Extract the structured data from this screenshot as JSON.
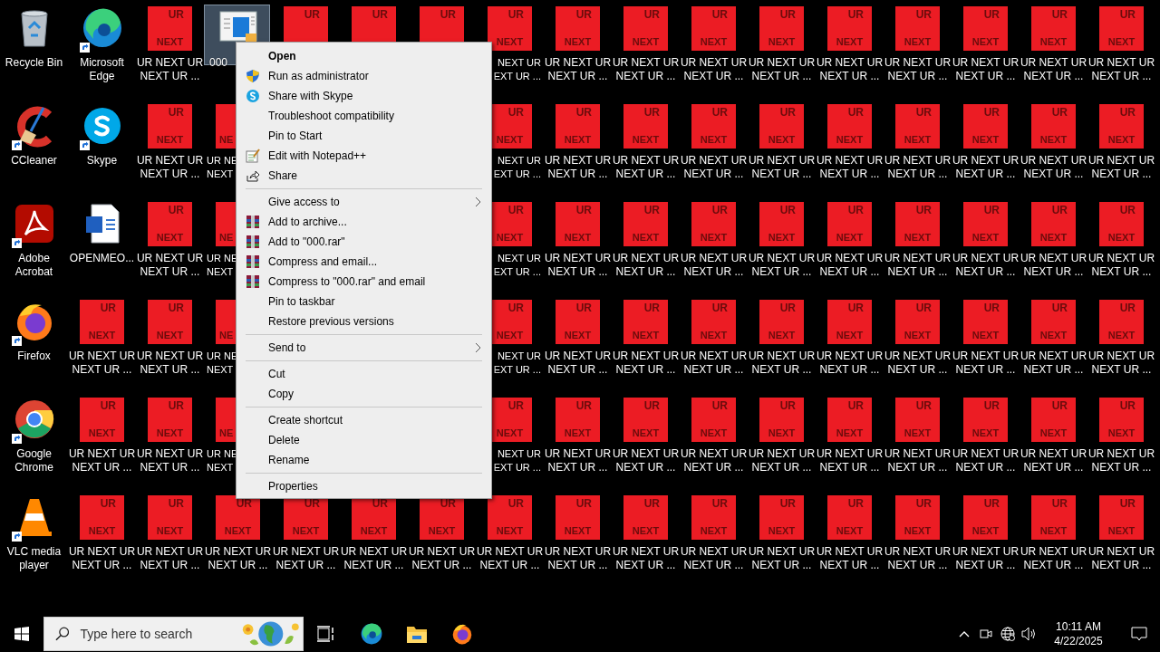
{
  "desktop": {
    "columns": [
      [
        {
          "kind": "recycle",
          "shortcut": false,
          "label": [
            "Recycle Bin"
          ]
        },
        {
          "kind": "ccleaner",
          "shortcut": true,
          "label": [
            "CCleaner"
          ]
        },
        {
          "kind": "acrobat",
          "shortcut": true,
          "label": [
            "Adobe",
            "Acrobat"
          ]
        },
        {
          "kind": "firefox",
          "shortcut": true,
          "label": [
            "Firefox"
          ]
        },
        {
          "kind": "chrome",
          "shortcut": true,
          "label": [
            "Google",
            "Chrome"
          ]
        },
        {
          "kind": "vlc",
          "shortcut": true,
          "label": [
            "VLC media",
            "player"
          ]
        }
      ],
      [
        {
          "kind": "edge",
          "shortcut": true,
          "label": [
            "Microsoft",
            "Edge"
          ]
        },
        {
          "kind": "skype",
          "shortcut": true,
          "label": [
            "Skype"
          ]
        },
        {
          "kind": "word",
          "shortcut": false,
          "label": [
            "OPENMEO..."
          ]
        },
        {
          "kind": "tile",
          "tile": {
            "top": "UR",
            "bottom": "NEXT"
          },
          "label": [
            "UR NEXT UR",
            "NEXT UR ..."
          ]
        },
        {
          "kind": "tile",
          "tile": {
            "top": "UR",
            "bottom": "NEXT"
          },
          "label": [
            "UR NEXT UR",
            "NEXT UR ..."
          ]
        },
        {
          "kind": "tile",
          "tile": {
            "top": "UR",
            "bottom": "NEXT"
          },
          "label": [
            "UR NEXT UR",
            "NEXT UR ..."
          ]
        }
      ],
      [
        {
          "kind": "tile",
          "tile": {
            "top": "UR",
            "bottom": "NEXT"
          },
          "label": [
            "UR NEXT UR",
            "NEXT UR ..."
          ]
        },
        {
          "kind": "tile",
          "tile": {
            "top": "UR",
            "bottom": "NEXT"
          },
          "label": [
            "UR NEXT UR",
            "NEXT UR ..."
          ]
        },
        {
          "kind": "tile",
          "tile": {
            "top": "UR",
            "bottom": "NEXT"
          },
          "label": [
            "UR NEXT UR",
            "NEXT UR ..."
          ]
        },
        {
          "kind": "tile",
          "tile": {
            "top": "UR",
            "bottom": "NEXT"
          },
          "label": [
            "UR NEXT UR",
            "NEXT UR ..."
          ]
        },
        {
          "kind": "tile",
          "tile": {
            "top": "UR",
            "bottom": "NEXT"
          },
          "label": [
            "UR NEXT UR",
            "NEXT UR ..."
          ]
        },
        {
          "kind": "tile",
          "tile": {
            "top": "UR",
            "bottom": "NEXT"
          },
          "label": [
            "UR NEXT UR",
            "NEXT UR ..."
          ]
        }
      ],
      [
        {
          "kind": "file",
          "selected": true,
          "label": [
            "000"
          ]
        },
        {
          "kind": "cutright",
          "tile": {
            "bottom": "NE"
          },
          "label": [
            "UR NE",
            "NEXT"
          ]
        },
        {
          "kind": "cutright",
          "tile": {
            "bottom": "NE"
          },
          "label": [
            "UR NE",
            "NEXT"
          ]
        },
        {
          "kind": "cutright",
          "tile": {
            "bottom": "NE"
          },
          "label": [
            "UR NE",
            "NEXT"
          ]
        },
        {
          "kind": "cutright",
          "tile": {
            "bottom": "NE"
          },
          "label": [
            "UR NE",
            "NEXT"
          ]
        },
        {
          "kind": "tile",
          "tile": {
            "top": "UR",
            "bottom": "NEXT"
          },
          "label": [
            "UR NEXT UR",
            "NEXT UR ..."
          ]
        }
      ],
      [
        {
          "kind": "cutbottom",
          "tile": {
            "top": "UR"
          }
        },
        {
          "kind": "covered"
        },
        {
          "kind": "covered"
        },
        {
          "kind": "covered"
        },
        {
          "kind": "covered"
        },
        {
          "kind": "tile",
          "tile": {
            "top": "UR",
            "bottom": "NEXT"
          },
          "label": [
            "UR NEXT UR",
            "NEXT UR ..."
          ]
        }
      ],
      [
        {
          "kind": "cutbottom",
          "tile": {
            "top": "UR"
          }
        },
        {
          "kind": "covered"
        },
        {
          "kind": "covered"
        },
        {
          "kind": "covered"
        },
        {
          "kind": "covered"
        },
        {
          "kind": "tile",
          "tile": {
            "top": "UR",
            "bottom": "NEXT"
          },
          "label": [
            "UR NEXT UR",
            "NEXT UR ..."
          ]
        }
      ],
      [
        {
          "kind": "cutbottom",
          "tile": {
            "top": "UR"
          }
        },
        {
          "kind": "covered"
        },
        {
          "kind": "covered"
        },
        {
          "kind": "covered"
        },
        {
          "kind": "covered"
        },
        {
          "kind": "tile",
          "tile": {
            "top": "UR",
            "bottom": "NEXT"
          },
          "label": [
            "UR NEXT UR",
            "NEXT UR ..."
          ]
        }
      ],
      [
        {
          "kind": "cutleft",
          "tile": {
            "top": "UR",
            "bottom": "NEXT"
          },
          "label": [
            "NEXT UR",
            "EXT UR ..."
          ]
        },
        {
          "kind": "cutleft",
          "tile": {
            "top": "UR",
            "bottom": "NEXT"
          },
          "label": [
            "NEXT UR",
            "EXT UR ..."
          ]
        },
        {
          "kind": "cutleft",
          "tile": {
            "top": "UR",
            "bottom": "NEXT"
          },
          "label": [
            "NEXT UR",
            "EXT UR ..."
          ]
        },
        {
          "kind": "cutleft",
          "tile": {
            "top": "UR",
            "bottom": "NEXT"
          },
          "label": [
            "NEXT UR",
            "EXT UR ..."
          ]
        },
        {
          "kind": "cutleft",
          "tile": {
            "top": "UR",
            "bottom": "NEXT"
          },
          "label": [
            "NEXT UR",
            "EXT UR ..."
          ]
        },
        {
          "kind": "tile",
          "tile": {
            "top": "UR",
            "bottom": "NEXT"
          },
          "label": [
            "UR NEXT UR",
            "NEXT UR ..."
          ]
        }
      ],
      [
        {
          "kind": "tile",
          "tile": {
            "top": "UR",
            "bottom": "NEXT"
          },
          "label": [
            "UR NEXT UR",
            "NEXT UR ..."
          ]
        },
        {
          "kind": "tile",
          "tile": {
            "top": "UR",
            "bottom": "NEXT"
          },
          "label": [
            "UR NEXT UR",
            "NEXT UR ..."
          ]
        },
        {
          "kind": "tile",
          "tile": {
            "top": "UR",
            "bottom": "NEXT"
          },
          "label": [
            "UR NEXT UR",
            "NEXT UR ..."
          ]
        },
        {
          "kind": "tile",
          "tile": {
            "top": "UR",
            "bottom": "NEXT"
          },
          "label": [
            "UR NEXT UR",
            "NEXT UR ..."
          ]
        },
        {
          "kind": "tile",
          "tile": {
            "top": "UR",
            "bottom": "NEXT"
          },
          "label": [
            "UR NEXT UR",
            "NEXT UR ..."
          ]
        },
        {
          "kind": "tile",
          "tile": {
            "top": "UR",
            "bottom": "NEXT"
          },
          "label": [
            "UR NEXT UR",
            "NEXT UR ..."
          ]
        }
      ],
      [
        {
          "kind": "tile",
          "tile": {
            "top": "UR",
            "bottom": "NEXT"
          },
          "label": [
            "UR NEXT UR",
            "NEXT UR ..."
          ]
        },
        {
          "kind": "tile",
          "tile": {
            "top": "UR",
            "bottom": "NEXT"
          },
          "label": [
            "UR NEXT UR",
            "NEXT UR ..."
          ]
        },
        {
          "kind": "tile",
          "tile": {
            "top": "UR",
            "bottom": "NEXT"
          },
          "label": [
            "UR NEXT UR",
            "NEXT UR ..."
          ]
        },
        {
          "kind": "tile",
          "tile": {
            "top": "UR",
            "bottom": "NEXT"
          },
          "label": [
            "UR NEXT UR",
            "NEXT UR ..."
          ]
        },
        {
          "kind": "tile",
          "tile": {
            "top": "UR",
            "bottom": "NEXT"
          },
          "label": [
            "UR NEXT UR",
            "NEXT UR ..."
          ]
        },
        {
          "kind": "tile",
          "tile": {
            "top": "UR",
            "bottom": "NEXT"
          },
          "label": [
            "UR NEXT UR",
            "NEXT UR ..."
          ]
        }
      ],
      [
        {
          "kind": "tile",
          "tile": {
            "top": "UR",
            "bottom": "NEXT"
          },
          "label": [
            "UR NEXT UR",
            "NEXT UR ..."
          ]
        },
        {
          "kind": "tile",
          "tile": {
            "top": "UR",
            "bottom": "NEXT"
          },
          "label": [
            "UR NEXT UR",
            "NEXT UR ..."
          ]
        },
        {
          "kind": "tile",
          "tile": {
            "top": "UR",
            "bottom": "NEXT"
          },
          "label": [
            "UR NEXT UR",
            "NEXT UR ..."
          ]
        },
        {
          "kind": "tile",
          "tile": {
            "top": "UR",
            "bottom": "NEXT"
          },
          "label": [
            "UR NEXT UR",
            "NEXT UR ..."
          ]
        },
        {
          "kind": "tile",
          "tile": {
            "top": "UR",
            "bottom": "NEXT"
          },
          "label": [
            "UR NEXT UR",
            "NEXT UR ..."
          ]
        },
        {
          "kind": "tile",
          "tile": {
            "top": "UR",
            "bottom": "NEXT"
          },
          "label": [
            "UR NEXT UR",
            "NEXT UR ..."
          ]
        }
      ],
      [
        {
          "kind": "tile",
          "tile": {
            "top": "UR",
            "bottom": "NEXT"
          },
          "label": [
            "UR NEXT UR",
            "NEXT UR ..."
          ]
        },
        {
          "kind": "tile",
          "tile": {
            "top": "UR",
            "bottom": "NEXT"
          },
          "label": [
            "UR NEXT UR",
            "NEXT UR ..."
          ]
        },
        {
          "kind": "tile",
          "tile": {
            "top": "UR",
            "bottom": "NEXT"
          },
          "label": [
            "UR NEXT UR",
            "NEXT UR ..."
          ]
        },
        {
          "kind": "tile",
          "tile": {
            "top": "UR",
            "bottom": "NEXT"
          },
          "label": [
            "UR NEXT UR",
            "NEXT UR ..."
          ]
        },
        {
          "kind": "tile",
          "tile": {
            "top": "UR",
            "bottom": "NEXT"
          },
          "label": [
            "UR NEXT UR",
            "NEXT UR ..."
          ]
        },
        {
          "kind": "tile",
          "tile": {
            "top": "UR",
            "bottom": "NEXT"
          },
          "label": [
            "UR NEXT UR",
            "NEXT UR ..."
          ]
        }
      ],
      [
        {
          "kind": "tile",
          "tile": {
            "top": "UR",
            "bottom": "NEXT"
          },
          "label": [
            "UR NEXT UR",
            "NEXT UR ..."
          ]
        },
        {
          "kind": "tile",
          "tile": {
            "top": "UR",
            "bottom": "NEXT"
          },
          "label": [
            "UR NEXT UR",
            "NEXT UR ..."
          ]
        },
        {
          "kind": "tile",
          "tile": {
            "top": "UR",
            "bottom": "NEXT"
          },
          "label": [
            "UR NEXT UR",
            "NEXT UR ..."
          ]
        },
        {
          "kind": "tile",
          "tile": {
            "top": "UR",
            "bottom": "NEXT"
          },
          "label": [
            "UR NEXT UR",
            "NEXT UR ..."
          ]
        },
        {
          "kind": "tile",
          "tile": {
            "top": "UR",
            "bottom": "NEXT"
          },
          "label": [
            "UR NEXT UR",
            "NEXT UR ..."
          ]
        },
        {
          "kind": "tile",
          "tile": {
            "top": "UR",
            "bottom": "NEXT"
          },
          "label": [
            "UR NEXT UR",
            "NEXT UR ..."
          ]
        }
      ],
      [
        {
          "kind": "tile",
          "tile": {
            "top": "UR",
            "bottom": "NEXT"
          },
          "label": [
            "UR NEXT UR",
            "NEXT UR ..."
          ]
        },
        {
          "kind": "tile",
          "tile": {
            "top": "UR",
            "bottom": "NEXT"
          },
          "label": [
            "UR NEXT UR",
            "NEXT UR ..."
          ]
        },
        {
          "kind": "tile",
          "tile": {
            "top": "UR",
            "bottom": "NEXT"
          },
          "label": [
            "UR NEXT UR",
            "NEXT UR ..."
          ]
        },
        {
          "kind": "tile",
          "tile": {
            "top": "UR",
            "bottom": "NEXT"
          },
          "label": [
            "UR NEXT UR",
            "NEXT UR ..."
          ]
        },
        {
          "kind": "tile",
          "tile": {
            "top": "UR",
            "bottom": "NEXT"
          },
          "label": [
            "UR NEXT UR",
            "NEXT UR ..."
          ]
        },
        {
          "kind": "tile",
          "tile": {
            "top": "UR",
            "bottom": "NEXT"
          },
          "label": [
            "UR NEXT UR",
            "NEXT UR ..."
          ]
        }
      ],
      [
        {
          "kind": "tile",
          "tile": {
            "top": "UR",
            "bottom": "NEXT"
          },
          "label": [
            "UR NEXT UR",
            "NEXT UR ..."
          ]
        },
        {
          "kind": "tile",
          "tile": {
            "top": "UR",
            "bottom": "NEXT"
          },
          "label": [
            "UR NEXT UR",
            "NEXT UR ..."
          ]
        },
        {
          "kind": "tile",
          "tile": {
            "top": "UR",
            "bottom": "NEXT"
          },
          "label": [
            "UR NEXT UR",
            "NEXT UR ..."
          ]
        },
        {
          "kind": "tile",
          "tile": {
            "top": "UR",
            "bottom": "NEXT"
          },
          "label": [
            "UR NEXT UR",
            "NEXT UR ..."
          ]
        },
        {
          "kind": "tile",
          "tile": {
            "top": "UR",
            "bottom": "NEXT"
          },
          "label": [
            "UR NEXT UR",
            "NEXT UR ..."
          ]
        },
        {
          "kind": "tile",
          "tile": {
            "top": "UR",
            "bottom": "NEXT"
          },
          "label": [
            "UR NEXT UR",
            "NEXT UR ..."
          ]
        }
      ],
      [
        {
          "kind": "tile",
          "tile": {
            "top": "UR",
            "bottom": "NEXT"
          },
          "label": [
            "UR NEXT UR",
            "NEXT UR ..."
          ]
        },
        {
          "kind": "tile",
          "tile": {
            "top": "UR",
            "bottom": "NEXT"
          },
          "label": [
            "UR NEXT UR",
            "NEXT UR ..."
          ]
        },
        {
          "kind": "tile",
          "tile": {
            "top": "UR",
            "bottom": "NEXT"
          },
          "label": [
            "UR NEXT UR",
            "NEXT UR ..."
          ]
        },
        {
          "kind": "tile",
          "tile": {
            "top": "UR",
            "bottom": "NEXT"
          },
          "label": [
            "UR NEXT UR",
            "NEXT UR ..."
          ]
        },
        {
          "kind": "tile",
          "tile": {
            "top": "UR",
            "bottom": "NEXT"
          },
          "label": [
            "UR NEXT UR",
            "NEXT UR ..."
          ]
        },
        {
          "kind": "tile",
          "tile": {
            "top": "UR",
            "bottom": "NEXT"
          },
          "label": [
            "UR NEXT UR",
            "NEXT UR ..."
          ]
        }
      ],
      [
        {
          "kind": "tile",
          "tile": {
            "top": "UR",
            "bottom": "NEXT"
          },
          "label": [
            "UR NEXT UR",
            "NEXT UR ..."
          ]
        },
        {
          "kind": "tile",
          "tile": {
            "top": "UR",
            "bottom": "NEXT"
          },
          "label": [
            "UR NEXT UR",
            "NEXT UR ..."
          ]
        },
        {
          "kind": "tile",
          "tile": {
            "top": "UR",
            "bottom": "NEXT"
          },
          "label": [
            "UR NEXT UR",
            "NEXT UR ..."
          ]
        },
        {
          "kind": "tile",
          "tile": {
            "top": "UR",
            "bottom": "NEXT"
          },
          "label": [
            "UR NEXT UR",
            "NEXT UR ..."
          ]
        },
        {
          "kind": "tile",
          "tile": {
            "top": "UR",
            "bottom": "NEXT"
          },
          "label": [
            "UR NEXT UR",
            "NEXT UR ..."
          ]
        },
        {
          "kind": "tile",
          "tile": {
            "top": "UR",
            "bottom": "NEXT"
          },
          "label": [
            "UR NEXT UR",
            "NEXT UR ..."
          ]
        }
      ]
    ]
  },
  "context_menu": {
    "items": [
      {
        "kind": "item",
        "label": "Open",
        "bold": true
      },
      {
        "kind": "item",
        "label": "Run as administrator"
      },
      {
        "kind": "item",
        "label": "Share with Skype"
      },
      {
        "kind": "item",
        "label": "Troubleshoot compatibility"
      },
      {
        "kind": "item",
        "label": "Pin to Start"
      },
      {
        "kind": "item",
        "label": "Edit with Notepad++"
      },
      {
        "kind": "item",
        "label": "Share"
      },
      {
        "kind": "separator"
      },
      {
        "kind": "item",
        "label": "Give access to",
        "submenu": true
      },
      {
        "kind": "item",
        "label": "Add to archive..."
      },
      {
        "kind": "item",
        "label": "Add to \"000.rar\""
      },
      {
        "kind": "item",
        "label": "Compress and email..."
      },
      {
        "kind": "item",
        "label": "Compress to \"000.rar\" and email"
      },
      {
        "kind": "item",
        "label": "Pin to taskbar"
      },
      {
        "kind": "item",
        "label": "Restore previous versions"
      },
      {
        "kind": "separator"
      },
      {
        "kind": "item",
        "label": "Send to",
        "submenu": true
      },
      {
        "kind": "separator"
      },
      {
        "kind": "item",
        "label": "Cut"
      },
      {
        "kind": "item",
        "label": "Copy"
      },
      {
        "kind": "separator"
      },
      {
        "kind": "item",
        "label": "Create shortcut"
      },
      {
        "kind": "item",
        "label": "Delete"
      },
      {
        "kind": "item",
        "label": "Rename"
      },
      {
        "kind": "separator"
      },
      {
        "kind": "item",
        "label": "Properties"
      }
    ]
  },
  "taskbar": {
    "search": {
      "placeholder": "Type here to search"
    },
    "clock": {
      "time": "10:11 AM",
      "date": "4/22/2025"
    }
  }
}
